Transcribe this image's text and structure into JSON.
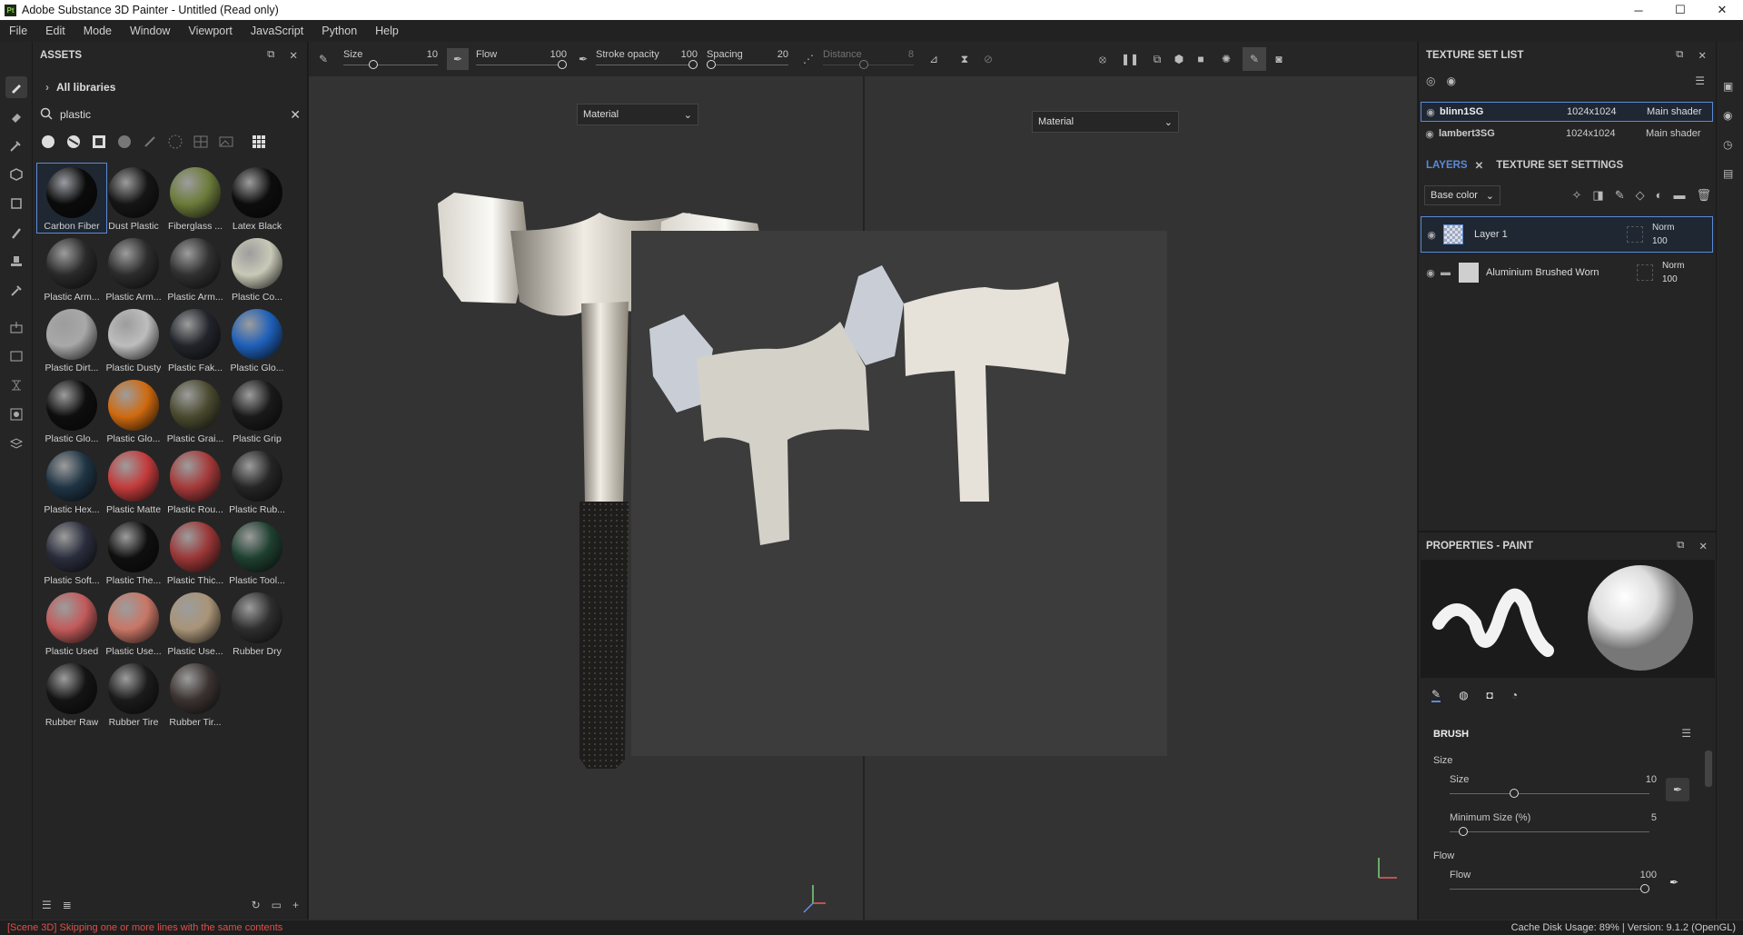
{
  "window": {
    "title": "Adobe Substance 3D Painter - Untitled (Read only)",
    "logo_text": "Pt",
    "min": "─",
    "max": "☐",
    "close": "✕"
  },
  "menu": [
    "File",
    "Edit",
    "Mode",
    "Window",
    "Viewport",
    "JavaScript",
    "Python",
    "Help"
  ],
  "assets": {
    "title": "ASSETS",
    "library": "All libraries",
    "search_value": "plastic",
    "items": [
      {
        "label": "Carbon Fiber",
        "color": "#0b0b0b",
        "selected": true
      },
      {
        "label": "Dust Plastic",
        "color": "#151515"
      },
      {
        "label": "Fiberglass ...",
        "color": "#6b7b3a"
      },
      {
        "label": "Latex Black",
        "color": "#0d0d0d"
      },
      {
        "label": "Plastic Arm...",
        "color": "#2a2a2a"
      },
      {
        "label": "Plastic Arm...",
        "color": "#2c2c2c"
      },
      {
        "label": "Plastic Arm...",
        "color": "#303030"
      },
      {
        "label": "Plastic Co...",
        "color": "#c9c9b8"
      },
      {
        "label": "Plastic Dirt...",
        "color": "#a8a8a8"
      },
      {
        "label": "Plastic Dusty",
        "color": "#bdbdbd"
      },
      {
        "label": "Plastic Fak...",
        "color": "#22242b"
      },
      {
        "label": "Plastic Glo...",
        "color": "#1e5fb8"
      },
      {
        "label": "Plastic Glo...",
        "color": "#0e0e0e"
      },
      {
        "label": "Plastic Glo...",
        "color": "#cf6a10"
      },
      {
        "label": "Plastic Grai...",
        "color": "#4a4a30"
      },
      {
        "label": "Plastic Grip",
        "color": "#1a1a1a"
      },
      {
        "label": "Plastic Hex...",
        "color": "#1f3444"
      },
      {
        "label": "Plastic Matte",
        "color": "#c33b3b"
      },
      {
        "label": "Plastic Rou...",
        "color": "#a53a3a"
      },
      {
        "label": "Plastic Rub...",
        "color": "#252525"
      },
      {
        "label": "Plastic Soft...",
        "color": "#2a2d3c"
      },
      {
        "label": "Plastic The...",
        "color": "#0f0f0f"
      },
      {
        "label": "Plastic Thic...",
        "color": "#9a3636"
      },
      {
        "label": "Plastic Tool...",
        "color": "#1e4030"
      },
      {
        "label": "Plastic Used",
        "color": "#c25a5a"
      },
      {
        "label": "Plastic Use...",
        "color": "#c87666"
      },
      {
        "label": "Plastic Use...",
        "color": "#a99478"
      },
      {
        "label": "Rubber Dry",
        "color": "#2e2e2e"
      },
      {
        "label": "Rubber Raw",
        "color": "#141414"
      },
      {
        "label": "Rubber Tire",
        "color": "#1b1b1b"
      },
      {
        "label": "Rubber Tir...",
        "color": "#3a3230"
      }
    ]
  },
  "toolbar": {
    "size_label": "Size",
    "size_value": "10",
    "flow_label": "Flow",
    "flow_value": "100",
    "stroke_label": "Stroke opacity",
    "stroke_value": "100",
    "spacing_label": "Spacing",
    "spacing_value": "20",
    "distance_label": "Distance",
    "distance_value": "8"
  },
  "viewport": {
    "left_mode": "Material",
    "right_mode": "Material"
  },
  "texture_set_list": {
    "title": "TEXTURE SET LIST",
    "sets": [
      {
        "name": "blinn1SG",
        "res": "1024x1024",
        "shader": "Main shader",
        "selected": true
      },
      {
        "name": "lambert3SG",
        "res": "1024x1024",
        "shader": "Main shader"
      }
    ]
  },
  "layers": {
    "tab_layers": "LAYERS",
    "tab_settings": "TEXTURE SET SETTINGS",
    "channel": "Base color",
    "items": [
      {
        "name": "Layer 1",
        "blend": "Norm",
        "opacity": "100"
      },
      {
        "name": "Aluminium Brushed Worn",
        "blend": "Norm",
        "opacity": "100"
      }
    ]
  },
  "properties": {
    "title": "PROPERTIES - PAINT",
    "section": "BRUSH",
    "size_group": "Size",
    "size_label": "Size",
    "size_value": "10",
    "min_size_label": "Minimum Size (%)",
    "min_size_value": "5",
    "flow_group": "Flow",
    "flow_label": "Flow",
    "flow_value": "100"
  },
  "status": {
    "message": "[Scene 3D] Skipping one or more lines with the same contents",
    "info": "Cache Disk Usage:   89% | Version: 9.1.2 (OpenGL)"
  }
}
